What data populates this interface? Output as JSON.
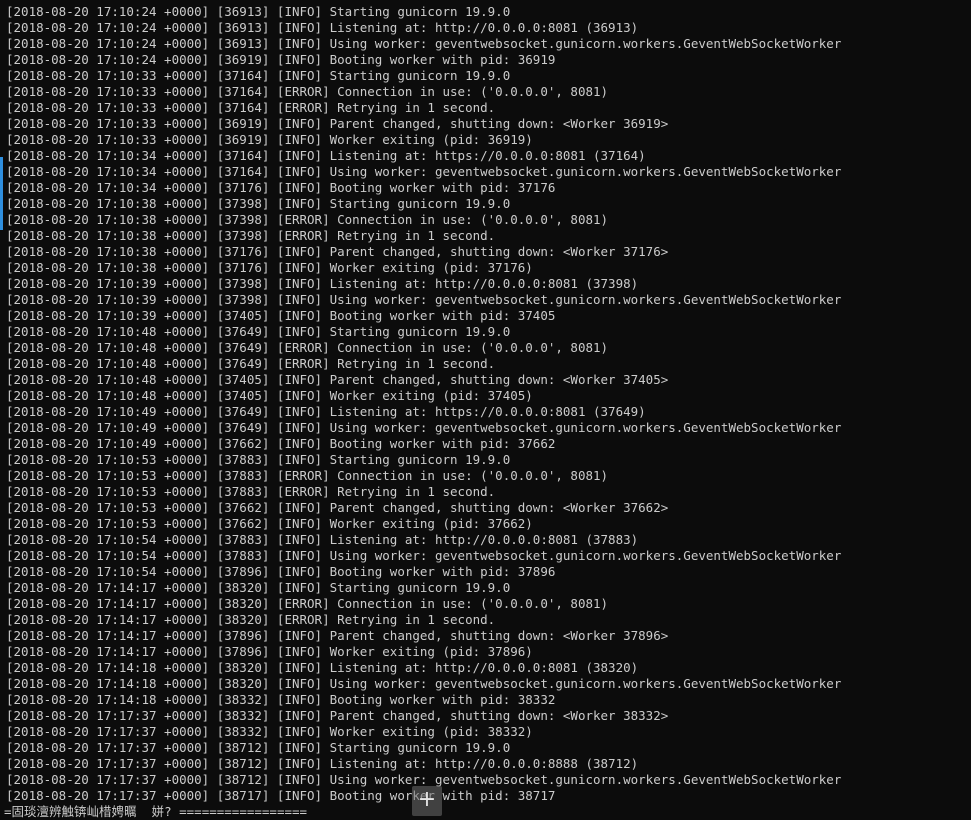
{
  "terminal": {
    "background": "#0c0c0c",
    "text_color": "#cccccc",
    "marker_color": "#2f8fdf",
    "lines": [
      "[2018-08-20 17:10:24 +0000] [36913] [INFO] Starting gunicorn 19.9.0",
      "[2018-08-20 17:10:24 +0000] [36913] [INFO] Listening at: http://0.0.0.0:8081 (36913)",
      "[2018-08-20 17:10:24 +0000] [36913] [INFO] Using worker: geventwebsocket.gunicorn.workers.GeventWebSocketWorker",
      "[2018-08-20 17:10:24 +0000] [36919] [INFO] Booting worker with pid: 36919",
      "[2018-08-20 17:10:33 +0000] [37164] [INFO] Starting gunicorn 19.9.0",
      "[2018-08-20 17:10:33 +0000] [37164] [ERROR] Connection in use: ('0.0.0.0', 8081)",
      "[2018-08-20 17:10:33 +0000] [37164] [ERROR] Retrying in 1 second.",
      "[2018-08-20 17:10:33 +0000] [36919] [INFO] Parent changed, shutting down: <Worker 36919>",
      "[2018-08-20 17:10:33 +0000] [36919] [INFO] Worker exiting (pid: 36919)",
      "[2018-08-20 17:10:34 +0000] [37164] [INFO] Listening at: https://0.0.0.0:8081 (37164)",
      "[2018-08-20 17:10:34 +0000] [37164] [INFO] Using worker: geventwebsocket.gunicorn.workers.GeventWebSocketWorker",
      "[2018-08-20 17:10:34 +0000] [37176] [INFO] Booting worker with pid: 37176",
      "[2018-08-20 17:10:38 +0000] [37398] [INFO] Starting gunicorn 19.9.0",
      "[2018-08-20 17:10:38 +0000] [37398] [ERROR] Connection in use: ('0.0.0.0', 8081)",
      "[2018-08-20 17:10:38 +0000] [37398] [ERROR] Retrying in 1 second.",
      "[2018-08-20 17:10:38 +0000] [37176] [INFO] Parent changed, shutting down: <Worker 37176>",
      "[2018-08-20 17:10:38 +0000] [37176] [INFO] Worker exiting (pid: 37176)",
      "[2018-08-20 17:10:39 +0000] [37398] [INFO] Listening at: http://0.0.0.0:8081 (37398)",
      "[2018-08-20 17:10:39 +0000] [37398] [INFO] Using worker: geventwebsocket.gunicorn.workers.GeventWebSocketWorker",
      "[2018-08-20 17:10:39 +0000] [37405] [INFO] Booting worker with pid: 37405",
      "[2018-08-20 17:10:48 +0000] [37649] [INFO] Starting gunicorn 19.9.0",
      "[2018-08-20 17:10:48 +0000] [37649] [ERROR] Connection in use: ('0.0.0.0', 8081)",
      "[2018-08-20 17:10:48 +0000] [37649] [ERROR] Retrying in 1 second.",
      "[2018-08-20 17:10:48 +0000] [37405] [INFO] Parent changed, shutting down: <Worker 37405>",
      "[2018-08-20 17:10:48 +0000] [37405] [INFO] Worker exiting (pid: 37405)",
      "[2018-08-20 17:10:49 +0000] [37649] [INFO] Listening at: https://0.0.0.0:8081 (37649)",
      "[2018-08-20 17:10:49 +0000] [37649] [INFO] Using worker: geventwebsocket.gunicorn.workers.GeventWebSocketWorker",
      "[2018-08-20 17:10:49 +0000] [37662] [INFO] Booting worker with pid: 37662",
      "[2018-08-20 17:10:53 +0000] [37883] [INFO] Starting gunicorn 19.9.0",
      "[2018-08-20 17:10:53 +0000] [37883] [ERROR] Connection in use: ('0.0.0.0', 8081)",
      "[2018-08-20 17:10:53 +0000] [37883] [ERROR] Retrying in 1 second.",
      "[2018-08-20 17:10:53 +0000] [37662] [INFO] Parent changed, shutting down: <Worker 37662>",
      "[2018-08-20 17:10:53 +0000] [37662] [INFO] Worker exiting (pid: 37662)",
      "[2018-08-20 17:10:54 +0000] [37883] [INFO] Listening at: http://0.0.0.0:8081 (37883)",
      "[2018-08-20 17:10:54 +0000] [37883] [INFO] Using worker: geventwebsocket.gunicorn.workers.GeventWebSocketWorker",
      "[2018-08-20 17:10:54 +0000] [37896] [INFO] Booting worker with pid: 37896",
      "[2018-08-20 17:14:17 +0000] [38320] [INFO] Starting gunicorn 19.9.0",
      "[2018-08-20 17:14:17 +0000] [38320] [ERROR] Connection in use: ('0.0.0.0', 8081)",
      "[2018-08-20 17:14:17 +0000] [38320] [ERROR] Retrying in 1 second.",
      "[2018-08-20 17:14:17 +0000] [37896] [INFO] Parent changed, shutting down: <Worker 37896>",
      "[2018-08-20 17:14:17 +0000] [37896] [INFO] Worker exiting (pid: 37896)",
      "[2018-08-20 17:14:18 +0000] [38320] [INFO] Listening at: http://0.0.0.0:8081 (38320)",
      "[2018-08-20 17:14:18 +0000] [38320] [INFO] Using worker: geventwebsocket.gunicorn.workers.GeventWebSocketWorker",
      "[2018-08-20 17:14:18 +0000] [38332] [INFO] Booting worker with pid: 38332",
      "[2018-08-20 17:17:37 +0000] [38332] [INFO] Parent changed, shutting down: <Worker 38332>",
      "[2018-08-20 17:17:37 +0000] [38332] [INFO] Worker exiting (pid: 38332)",
      "[2018-08-20 17:17:37 +0000] [38712] [INFO] Starting gunicorn 19.9.0",
      "[2018-08-20 17:17:37 +0000] [38712] [INFO] Listening at: http://0.0.0.0:8888 (38712)",
      "[2018-08-20 17:17:37 +0000] [38712] [INFO] Using worker: geventwebsocket.gunicorn.workers.GeventWebSocketWorker",
      "[2018-08-20 17:17:37 +0000] [38717] [INFO] Booting worker with pid: 38717"
    ],
    "status_line": "=固琰澶辨触锛屾棤娉曞  姘? ================="
  },
  "overlay": {
    "icon": "plus-icon",
    "glyph": "+"
  }
}
